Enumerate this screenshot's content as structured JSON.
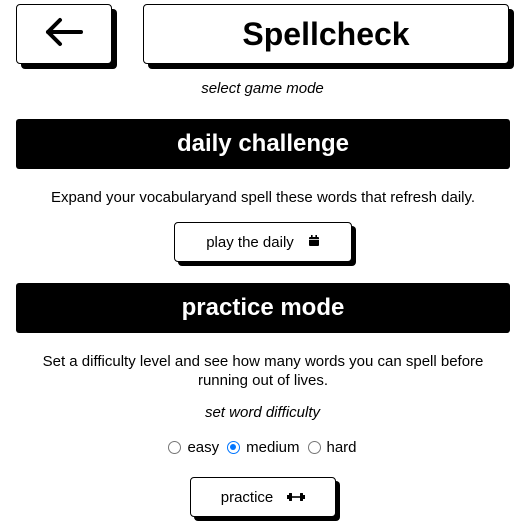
{
  "header": {
    "back_icon": "arrow-left-icon",
    "title": "Spellcheck"
  },
  "mode_prompt": "select game mode",
  "daily": {
    "heading": "daily challenge",
    "description": "Expand your vocabularyand spell these words that refresh daily.",
    "button_label": "play the daily",
    "button_icon": "calendar-icon"
  },
  "practice": {
    "heading": "practice mode",
    "description": "Set a difficulty level and see how many words you can spell before running out of lives.",
    "difficulty_prompt": "set word difficulty",
    "difficulty_options": [
      {
        "label": "easy",
        "selected": false
      },
      {
        "label": "medium",
        "selected": true
      },
      {
        "label": "hard",
        "selected": false
      }
    ],
    "button_label": "practice",
    "button_icon": "dumbbell-icon"
  },
  "colors": {
    "accent": "#000000",
    "radio_selected": "#0075ff"
  }
}
